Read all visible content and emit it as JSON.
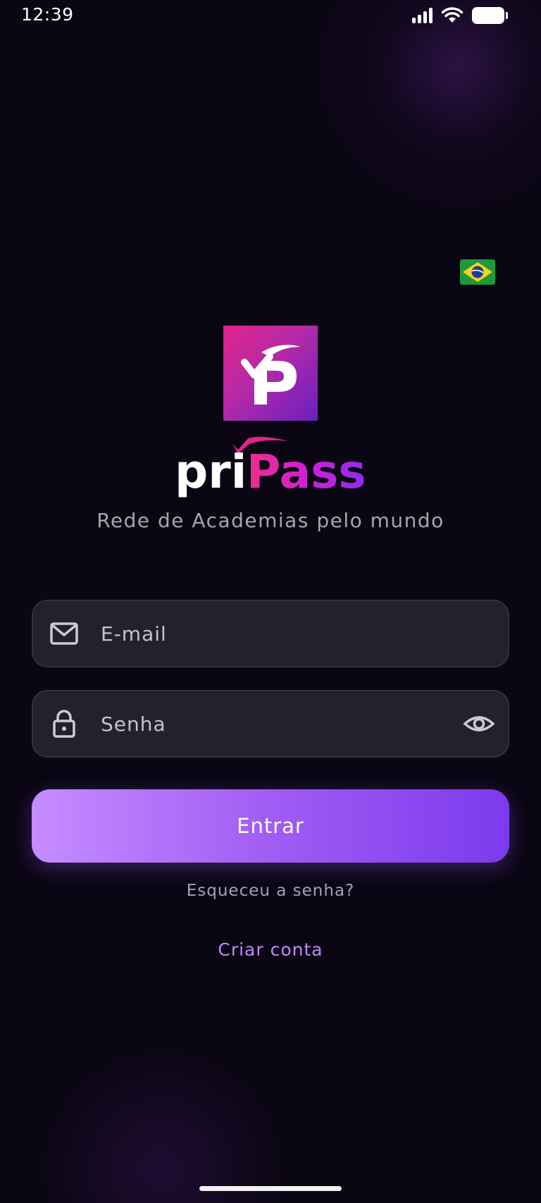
{
  "status_bar": {
    "time": "12:39",
    "icons": [
      "signal-icon",
      "wifi-icon",
      "battery-icon"
    ]
  },
  "language": {
    "flag": "brazil-flag-icon"
  },
  "brand": {
    "logo": "pripass-logo-icon",
    "name_part1": "pri",
    "name_part2": "Pass",
    "tagline": "Rede de Academias pelo mundo",
    "colors": {
      "pink": "#e0248a",
      "purple": "#7c3aed",
      "magenta": "#d01ed8"
    }
  },
  "form": {
    "email": {
      "placeholder": "E-mail",
      "value": "",
      "icon": "mail-icon"
    },
    "password": {
      "placeholder": "Senha",
      "value": "",
      "icon": "lock-icon",
      "toggle_icon": "eye-icon"
    },
    "submit_label": "Entrar",
    "forgot_label": "Esqueceu a senha?",
    "create_label": "Criar conta"
  },
  "theme": {
    "background": "#0a0613",
    "field_background": "#24212d",
    "button_gradient": [
      "#c68cff",
      "#7c3aed"
    ],
    "link_color": "#c08af8"
  }
}
